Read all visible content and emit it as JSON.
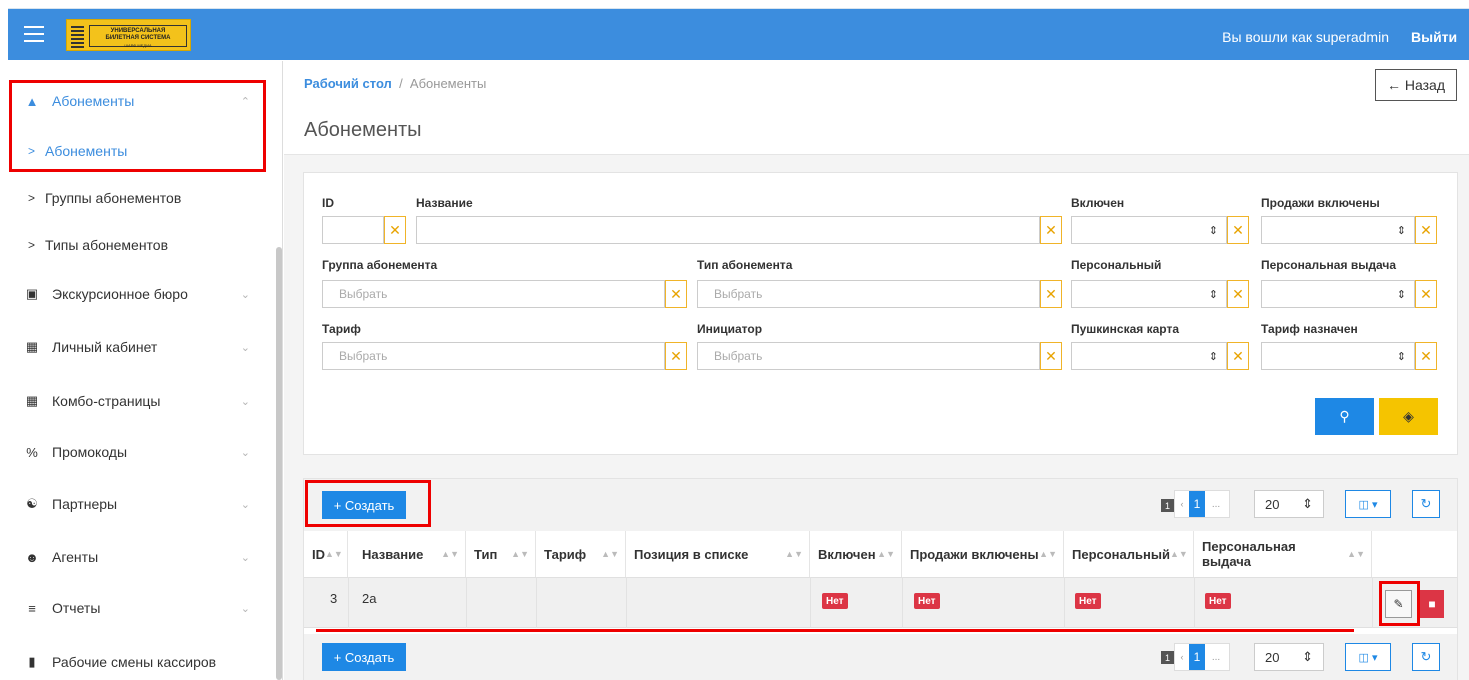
{
  "header": {
    "logo_line1": "УНИВЕРСАЛЬНАЯ",
    "logo_line2": "БИЛЕТНАЯ СИСТЕМА",
    "logo_line3": "ШАРФ МЕДИА",
    "login_text": "Вы вошли как superadmin",
    "logout_label": "Выйти"
  },
  "sidebar": {
    "items": [
      {
        "label": "Абонементы",
        "icon": "sitemap-icon"
      },
      {
        "label": "Абонементы"
      },
      {
        "label": "Группы абонементов"
      },
      {
        "label": "Типы абонементов"
      },
      {
        "label": "Экскурсионное бюро",
        "icon": "desktop-icon"
      },
      {
        "label": "Личный кабинет",
        "icon": "calendar-icon"
      },
      {
        "label": "Комбо-страницы",
        "icon": "calendar-icon"
      },
      {
        "label": "Промокоды",
        "icon": "percent-icon"
      },
      {
        "label": "Партнеры",
        "icon": "handshake-icon"
      },
      {
        "label": "Агенты",
        "icon": "user-circle-icon"
      },
      {
        "label": "Отчеты",
        "icon": "list-icon"
      },
      {
        "label": "Рабочие смены кассиров",
        "icon": "file-icon"
      }
    ]
  },
  "breadcrumb": {
    "home": "Рабочий стол",
    "sep": "/",
    "current": "Абонементы"
  },
  "back_label": "← Назад",
  "page_title": "Абонементы",
  "filters": {
    "id": "ID",
    "name": "Название",
    "enabled": "Включен",
    "sales_enabled": "Продажи включены",
    "group": "Группа абонемента",
    "type": "Тип абонемента",
    "personal": "Персональный",
    "personal_issue": "Персональная выдача",
    "tariff": "Тариф",
    "initiator": "Инициатор",
    "pushkin_card": "Пушкинская карта",
    "tariff_assigned": "Тариф назначен",
    "placeholder": "Выбрать"
  },
  "toolbar": {
    "create_label": "+ Создать",
    "page_count": "1",
    "current_page": "1",
    "per_page": "20"
  },
  "table": {
    "columns": [
      "ID",
      "Название",
      "Тип",
      "Тариф",
      "Позиция в списке",
      "Включен",
      "Продажи включены",
      "Персональный",
      "Персональная выдача"
    ],
    "rows": [
      {
        "id": "3",
        "name": "2а",
        "type": "",
        "tariff": "",
        "position": "",
        "enabled": "Нет",
        "sales_enabled": "Нет",
        "personal": "Нет",
        "personal_issue": "Нет"
      }
    ]
  },
  "colors": {
    "primary": "#3c8dde",
    "button": "#1e88e5",
    "warning": "#f5c400",
    "danger": "#dc3545",
    "highlight": "#ee0000"
  }
}
